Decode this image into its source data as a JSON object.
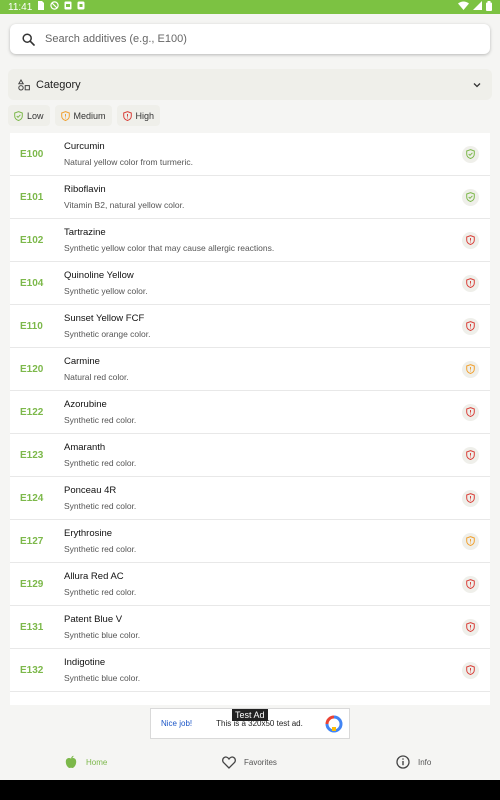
{
  "status_bar": {
    "time": "11:41",
    "bg_color": "#7cc242"
  },
  "search": {
    "placeholder": "Search additives (e.g., E100)"
  },
  "category": {
    "label": "Category"
  },
  "filters": [
    {
      "label": "Low",
      "color": "#7cb84a"
    },
    {
      "label": "Medium",
      "color": "#f0a030"
    },
    {
      "label": "High",
      "color": "#d9403a"
    }
  ],
  "additives": [
    {
      "code": "E100",
      "name": "Curcumin",
      "description": "Natural yellow color from turmeric.",
      "risk": "low"
    },
    {
      "code": "E101",
      "name": "Riboflavin",
      "description": "Vitamin B2, natural yellow color.",
      "risk": "low"
    },
    {
      "code": "E102",
      "name": "Tartrazine",
      "description": "Synthetic yellow color that may cause allergic reactions.",
      "risk": "high"
    },
    {
      "code": "E104",
      "name": "Quinoline Yellow",
      "description": "Synthetic yellow color.",
      "risk": "high"
    },
    {
      "code": "E110",
      "name": "Sunset Yellow FCF",
      "description": "Synthetic orange color.",
      "risk": "high"
    },
    {
      "code": "E120",
      "name": "Carmine",
      "description": "Natural red color.",
      "risk": "medium"
    },
    {
      "code": "E122",
      "name": "Azorubine",
      "description": "Synthetic red color.",
      "risk": "high"
    },
    {
      "code": "E123",
      "name": "Amaranth",
      "description": "Synthetic red color.",
      "risk": "high"
    },
    {
      "code": "E124",
      "name": "Ponceau 4R",
      "description": "Synthetic red color.",
      "risk": "high"
    },
    {
      "code": "E127",
      "name": "Erythrosine",
      "description": "Synthetic red color.",
      "risk": "medium"
    },
    {
      "code": "E129",
      "name": "Allura Red AC",
      "description": "Synthetic red color.",
      "risk": "high"
    },
    {
      "code": "E131",
      "name": "Patent Blue V",
      "description": "Synthetic blue color.",
      "risk": "high"
    },
    {
      "code": "E132",
      "name": "Indigotine",
      "description": "Synthetic blue color.",
      "risk": "high"
    }
  ],
  "ad": {
    "badge": "Test Ad",
    "left": "Nice job!",
    "text": "This is a 320x50 test ad."
  },
  "bottom_nav": {
    "home": "Home",
    "favorites": "Favorites",
    "info": "Info"
  }
}
